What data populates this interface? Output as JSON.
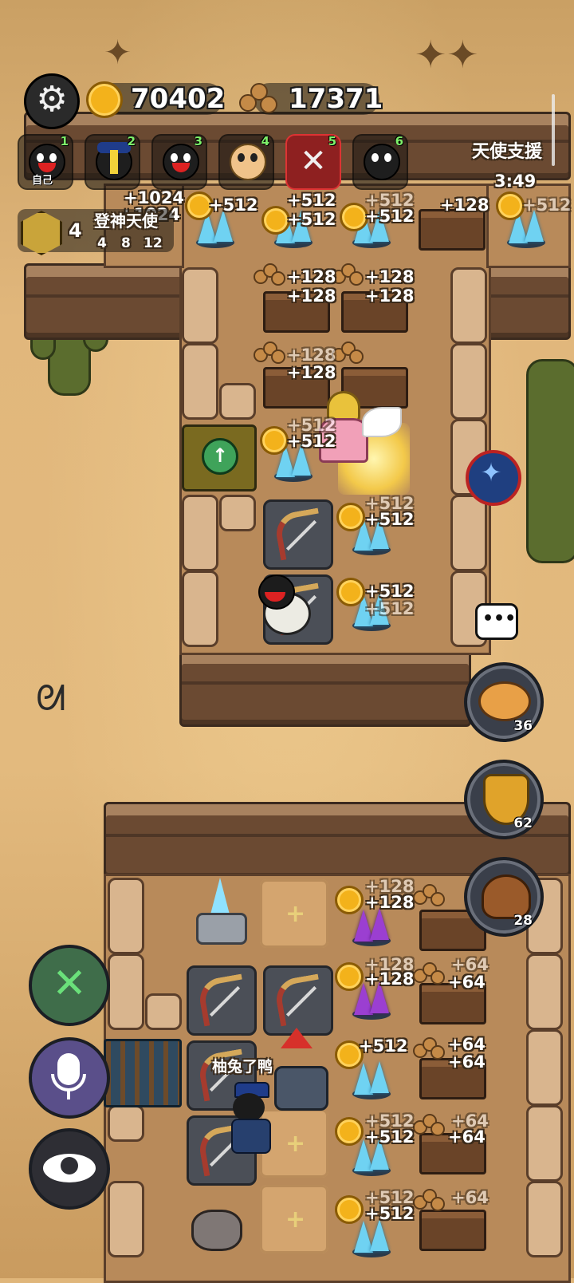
{
  "hud": {
    "gold": "70402",
    "wood": "17371",
    "settings_icon": "gear-icon",
    "gold_icon": "gold-coin-icon",
    "wood_icon": "log-bundle-icon"
  },
  "players": [
    {
      "num": "1",
      "label": "自己",
      "avatar": "black-sheep-face"
    },
    {
      "num": "2",
      "label": "",
      "avatar": "black-sheep-hat"
    },
    {
      "num": "3",
      "label": "",
      "avatar": "black-sheep-face"
    },
    {
      "num": "4",
      "label": "",
      "avatar": "white-sheep-face"
    },
    {
      "num": "5",
      "label": "",
      "avatar": "claw-monster"
    },
    {
      "num": "6",
      "label": "",
      "avatar": "black-sheep-smile"
    }
  ],
  "event": {
    "title": "天使支援",
    "timer": "3:49"
  },
  "rank": {
    "level": "4",
    "title": "登神天使",
    "steps": [
      "4",
      "8",
      "12"
    ]
  },
  "labels": {
    "g1024a": "+1024",
    "g1024b": "+1024",
    "g512a": "+512",
    "g512b": "+512",
    "g512c": "+512",
    "g512d": "+512",
    "g512e": "+512",
    "g512f": "+512",
    "w128a": "+128",
    "w128b": "+128",
    "w128c": "+128",
    "w128d": "+128",
    "w128e": "+128",
    "w128f": "+128",
    "w128g": "+128",
    "g512g": "+512",
    "g512h": "+512",
    "g512i": "+512",
    "g512j": "+512",
    "g512k": "+512",
    "g512l": "+512",
    "p128a": "+128",
    "p128b": "+128",
    "p128c": "+128",
    "p128d": "+128",
    "w64a": "+64",
    "w64b": "+64",
    "w64c": "+64",
    "w64d": "+64",
    "w64e": "+64",
    "w64f": "+64",
    "w64g": "+64",
    "g512m": "+512",
    "g512n": "+512",
    "g512o": "+512",
    "g512p": "+512",
    "g512q": "+512"
  },
  "player_name": "柚兔了鸭",
  "side_buttons": [
    {
      "name": "piggy-bank",
      "count": "36"
    },
    {
      "name": "shield",
      "count": "62"
    },
    {
      "name": "poop",
      "count": "28"
    }
  ],
  "tools": {
    "build": "hammer-wrench-icon",
    "mic": "microphone-icon",
    "view": "eye-icon",
    "chat": "chat-bubble-icon"
  },
  "colors": {
    "accent_red": "#d33",
    "gold": "#f3b21b",
    "crystal_blue": "#6fd2f2",
    "crystal_purple": "#9b3fd1",
    "green_num": "#7ef06a"
  }
}
